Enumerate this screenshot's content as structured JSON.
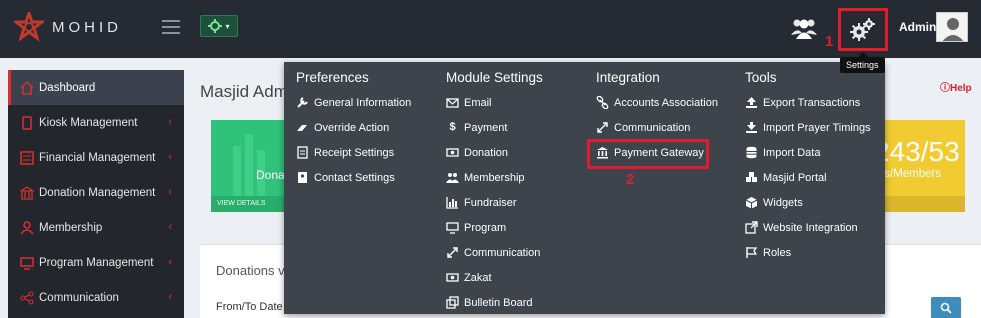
{
  "app": {
    "brand": "MOHID"
  },
  "header": {
    "admin_name": "Admin",
    "settings_tooltip": "Settings",
    "step1": "1",
    "step2": "2"
  },
  "sidebar": {
    "items": [
      {
        "label": "Dashboard",
        "icon": "home-icon"
      },
      {
        "label": "Kiosk Management",
        "icon": "tablet-icon"
      },
      {
        "label": "Financial Management",
        "icon": "calculator-icon"
      },
      {
        "label": "Donation Management",
        "icon": "bank-icon"
      },
      {
        "label": "Membership",
        "icon": "user-icon"
      },
      {
        "label": "Program Management",
        "icon": "monitor-icon"
      },
      {
        "label": "Communication",
        "icon": "share-icon"
      }
    ]
  },
  "main": {
    "page_title": "Masjid Adm",
    "help": "Help",
    "green_card_label": "Dona",
    "green_card_footer": "VIEW DETAILS",
    "yellow_card_value": "243/53",
    "yellow_card_label": "ors/Members",
    "panel_title": "Donations v",
    "panel_sub": "From/To Date"
  },
  "dropdown": {
    "preferences": {
      "title": "Preferences",
      "items": [
        "General Information",
        "Override Action",
        "Receipt Settings",
        "Contact Settings"
      ]
    },
    "module_settings": {
      "title": "Module Settings",
      "items": [
        "Email",
        "Payment",
        "Donation",
        "Membership",
        "Fundraiser",
        "Program",
        "Communication",
        "Zakat",
        "Bulletin Board"
      ]
    },
    "integration": {
      "title": "Integration",
      "items": [
        "Accounts Association",
        "Communication",
        "Payment Gateway"
      ]
    },
    "tools": {
      "title": "Tools",
      "items": [
        "Export Transactions",
        "Import Prayer Timings",
        "Import Data",
        "Masjid Portal",
        "Widgets",
        "Website Integration",
        "Roles"
      ]
    }
  },
  "colors": {
    "topbar": "#252a33",
    "dropdown_bg": "#3d444c",
    "highlight_red": "#e01e2b",
    "card_green": "#2fc27a",
    "card_yellow": "#f2ca32"
  }
}
